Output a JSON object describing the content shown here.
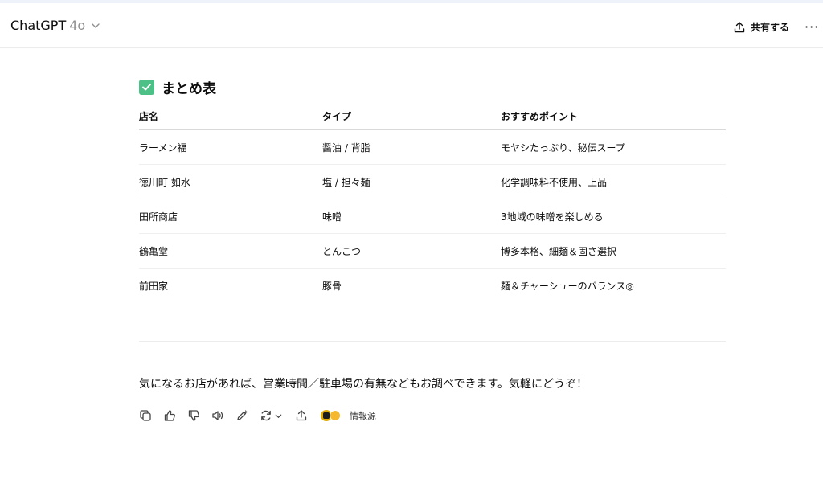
{
  "header": {
    "app_name": "ChatGPT",
    "model_version": "4o",
    "share_label": "共有する",
    "more_label": "···"
  },
  "response": {
    "heading": "まとめ表",
    "table": {
      "headers": [
        "店名",
        "タイプ",
        "おすすめポイント"
      ],
      "rows": [
        [
          "ラーメン福",
          "醤油 / 背脂",
          "モヤシたっぷり、秘伝スープ"
        ],
        [
          "徳川町 如水",
          "塩 / 担々麺",
          "化学調味料不使用、上品"
        ],
        [
          "田所商店",
          "味噌",
          "3地域の味噌を楽しめる"
        ],
        [
          "鶴亀堂",
          "とんこつ",
          "博多本格、細麺＆固さ選択"
        ],
        [
          "前田家",
          "豚骨",
          "麺＆チャーシューのバランス◎"
        ]
      ]
    },
    "message": "気になるお店があれば、営業時間／駐車場の有無などもお調べできます。気軽にどうぞ！",
    "sources_label": "情報源"
  },
  "colors": {
    "check_badge": "#4cc087",
    "muted": "#8f8f8f"
  },
  "icons": [
    "chevron-down-icon",
    "share-icon",
    "check-icon",
    "copy-icon",
    "thumbs-up-icon",
    "thumbs-down-icon",
    "speaker-icon",
    "edit-icon",
    "regenerate-icon",
    "upload-icon"
  ]
}
